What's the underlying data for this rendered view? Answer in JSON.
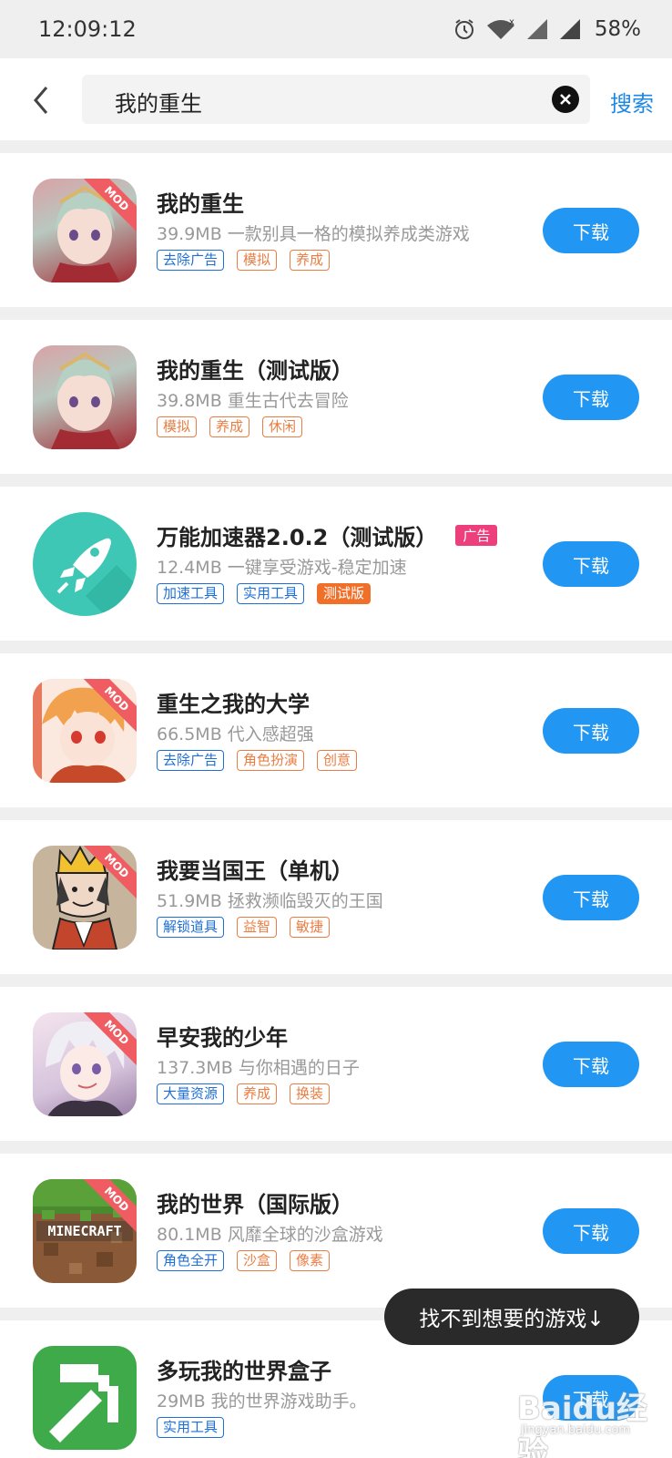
{
  "status_bar": {
    "time": "12:09:12",
    "battery": "58%"
  },
  "search": {
    "query": "我的重生",
    "submit_label": "搜索"
  },
  "results": [
    {
      "title": "我的重生",
      "desc": "39.9MB  一款别具一格的模拟养成类游戏",
      "mod": true,
      "tags": [
        {
          "text": "去除广告",
          "style": "blue"
        },
        {
          "text": "模拟",
          "style": "orange"
        },
        {
          "text": "养成",
          "style": "orange"
        }
      ],
      "download_label": "下载",
      "icon": "anime-girl-icon"
    },
    {
      "title": "我的重生（测试版）",
      "desc": "39.8MB  重生古代去冒险",
      "mod": false,
      "tags": [
        {
          "text": "模拟",
          "style": "orange"
        },
        {
          "text": "养成",
          "style": "orange"
        },
        {
          "text": "休闲",
          "style": "orange"
        }
      ],
      "download_label": "下载",
      "icon": "anime-girl-icon"
    },
    {
      "title": "万能加速器2.0.2（测试版）",
      "ad_badge": "广告",
      "desc": "12.4MB  一键享受游戏-稳定加速",
      "mod": false,
      "tags": [
        {
          "text": "加速工具",
          "style": "blue"
        },
        {
          "text": "实用工具",
          "style": "blue"
        },
        {
          "text": "测试版",
          "style": "solid"
        }
      ],
      "download_label": "下载",
      "icon": "rocket-icon"
    },
    {
      "title": "重生之我的大学",
      "desc": "66.5MB  代入感超强",
      "mod": true,
      "tags": [
        {
          "text": "去除广告",
          "style": "blue"
        },
        {
          "text": "角色扮演",
          "style": "orange"
        },
        {
          "text": "创意",
          "style": "orange"
        }
      ],
      "download_label": "下载",
      "icon": "anime-boy-icon"
    },
    {
      "title": "我要当国王（单机）",
      "desc": "51.9MB  拯救濒临毁灭的王国",
      "mod": true,
      "tags": [
        {
          "text": "解锁道具",
          "style": "blue"
        },
        {
          "text": "益智",
          "style": "orange"
        },
        {
          "text": "敏捷",
          "style": "orange"
        }
      ],
      "download_label": "下载",
      "icon": "king-icon"
    },
    {
      "title": "早安我的少年",
      "desc": "137.3MB  与你相遇的日子",
      "mod": true,
      "tags": [
        {
          "text": "大量资源",
          "style": "blue"
        },
        {
          "text": "养成",
          "style": "orange"
        },
        {
          "text": "换装",
          "style": "orange"
        }
      ],
      "download_label": "下载",
      "icon": "anime-youth-icon"
    },
    {
      "title": "我的世界（国际版）",
      "desc": "80.1MB  风靡全球的沙盒游戏",
      "mod": true,
      "tags": [
        {
          "text": "角色全开",
          "style": "blue"
        },
        {
          "text": "沙盒",
          "style": "orange"
        },
        {
          "text": "像素",
          "style": "orange"
        }
      ],
      "download_label": "下载",
      "icon": "minecraft-icon",
      "icon_text": "MINECRAFT"
    },
    {
      "title": "多玩我的世界盒子",
      "desc": "29MB  我的世界游戏助手。",
      "mod": false,
      "tags": [
        {
          "text": "实用工具",
          "style": "blue"
        }
      ],
      "download_label": "下载",
      "icon": "pickaxe-icon"
    }
  ],
  "mod_label": "MOD",
  "toast": "找不到想要的游戏↓",
  "watermark": {
    "logo": "Baidu经验",
    "url": "jingyan.baidu.com"
  }
}
